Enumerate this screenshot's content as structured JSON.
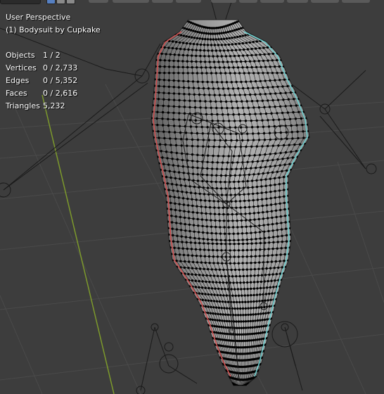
{
  "viewport": {
    "view_name": "User Perspective",
    "active_object": "(1) Bodysuit by Cupkake"
  },
  "stats": [
    {
      "label": "Objects",
      "value": "1 / 2"
    },
    {
      "label": "Vertices",
      "value": "0 / 2,733"
    },
    {
      "label": "Edges",
      "value": "0 / 5,352"
    },
    {
      "label": "Faces",
      "value": "0 / 2,616"
    },
    {
      "label": "Triangles",
      "value": "5,232"
    }
  ],
  "colors": {
    "background": "#3d3d3d",
    "grid": "#484848",
    "y_axis": "#7d9a2c",
    "mesh_fill": "#9a9a9a",
    "wire": "#111111",
    "seam_red": "#d05050",
    "seam_cyan": "#6fd0d0",
    "bone_line": "#1a1a1a",
    "active_button": "#5680c2"
  },
  "toolbar": {
    "icons": [
      "vertex-select-icon",
      "edge-select-icon",
      "face-select-icon"
    ]
  }
}
